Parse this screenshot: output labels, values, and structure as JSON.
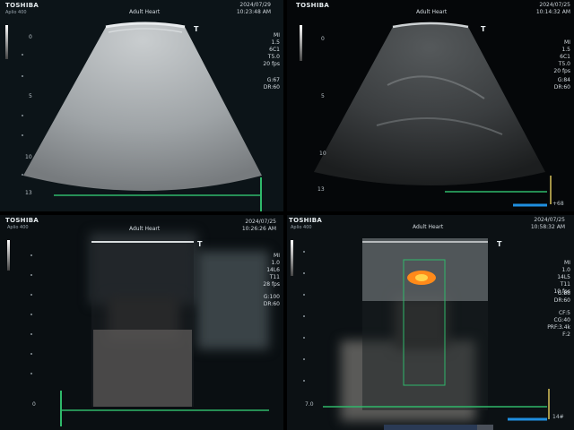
{
  "panels": [
    {
      "brand": "TOSHIBA",
      "model": "Aplio 400",
      "preset": "Adult Heart",
      "date": "2024/07/29",
      "time": "10:23:48 AM",
      "params": "MI\n1.5\n6C1\nT5.0\n20 fps",
      "gain": "G:67\nDR:60",
      "depth_top": "0",
      "depth_mid": "5",
      "depth_low": "10",
      "depth_bottom": "13"
    },
    {
      "brand": "TOSHIBA",
      "preset": "Adult Heart",
      "date": "2024/07/25",
      "time": "10:14:32 AM",
      "params": "MI\n1.5\n6C1\nT5.0\n20 fps",
      "gain": "G:84\nDR:60",
      "depth_top": "0",
      "depth_mid": "5",
      "depth_low": "10",
      "depth_bottom": "13",
      "extra": "+68"
    },
    {
      "brand": "TOSHIBA",
      "model": "Aplio 400",
      "preset": "Adult Heart",
      "date": "2024/07/25",
      "time": "10:26:26 AM",
      "params": "MI\n1.0\n14L6\nT11\n28 fps",
      "gain": "G:100\nDR:60",
      "depth_bottom": "0"
    },
    {
      "brand": "TOSHIBA",
      "model": "Aplio 400",
      "preset": "Adult Heart",
      "date": "2024/07/25",
      "time": "10:58:32 AM",
      "params": "MI\n1.0\n14L5\nT11\n10 fps",
      "gain": "G:88\nDR:60",
      "cf": "CF:5\nCG:40\nPRF:3.4k\nF:2",
      "depth_bottom": "7.0",
      "extra": "14#"
    }
  ],
  "colors": {
    "scan_green": "#2fb86a",
    "blue_bar": "#1f8fe0",
    "yellow_marker": "#d8c25a",
    "doppler_orange": "#ff8a1a"
  }
}
